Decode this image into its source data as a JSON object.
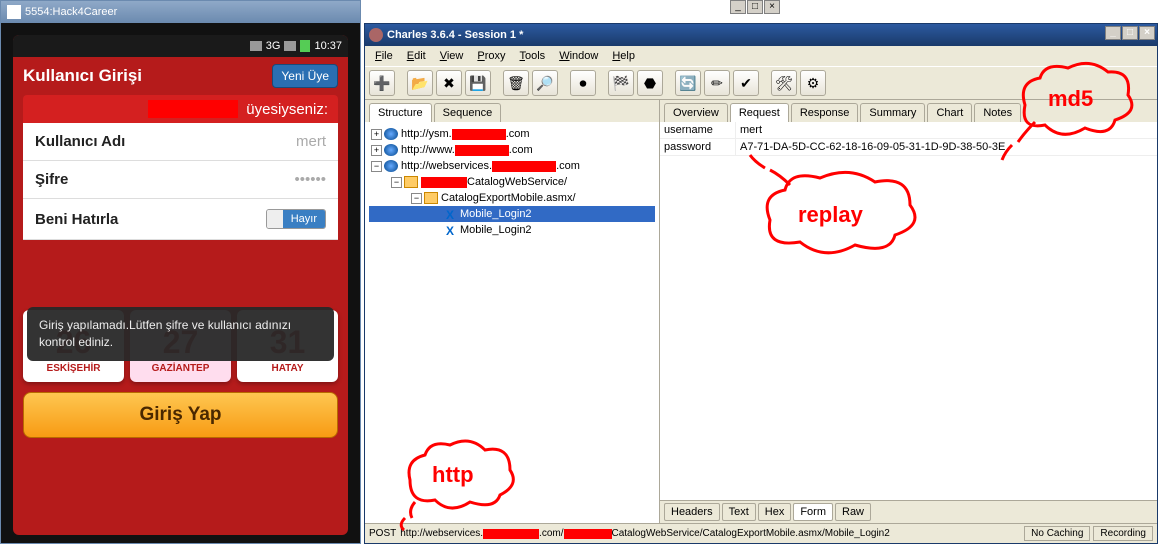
{
  "emulator": {
    "title": "5554:Hack4Career",
    "statusbar": {
      "net": "3G",
      "time": "10:37"
    },
    "app": {
      "header_title": "Kullanıcı Girişi",
      "new_member": "Yeni Üye",
      "banner_suffix": "üyesiyseniz:",
      "username_label": "Kullanıcı Adı",
      "username_value": "mert",
      "password_label": "Şifre",
      "password_mask": "••••••",
      "remember_label": "Beni Hatırla",
      "toggle_on": " ",
      "toggle_off": "Hayır",
      "toast": "Giriş yapılamadı.Lütfen şifre ve kullanıcı adınızı kontrol ediniz.",
      "days": [
        {
          "num": "26",
          "city": "ESKİŞEHİR"
        },
        {
          "num": "27",
          "city": "GAZİANTEP"
        },
        {
          "num": "31",
          "city": "HATAY"
        }
      ],
      "login_button": "Giriş Yap"
    }
  },
  "charles": {
    "title": "Charles 3.6.4 - Session 1 *",
    "menu": [
      "File",
      "Edit",
      "View",
      "Proxy",
      "Tools",
      "Window",
      "Help"
    ],
    "left_tabs": [
      "Structure",
      "Sequence"
    ],
    "tree": {
      "h1_pre": "http://ysm.",
      "h1_post": ".com",
      "h2_pre": "http://www.",
      "h2_post": ".com",
      "h3_pre": "http://webservices.",
      "h3_post": ".com",
      "f1": "CatalogWebService/",
      "f2": "CatalogExportMobile.asmx/",
      "l1": "Mobile_Login2",
      "l2": "Mobile_Login2"
    },
    "right_tabs": [
      "Overview",
      "Request",
      "Response",
      "Summary",
      "Chart",
      "Notes"
    ],
    "request": {
      "rows": [
        {
          "k": "username",
          "v": "mert"
        },
        {
          "k": "password",
          "v": "A7-71-DA-5D-CC-62-18-16-09-05-31-1D-9D-38-50-3E"
        }
      ]
    },
    "bottom_tabs": [
      "Headers",
      "Text",
      "Hex",
      "Form",
      "Raw"
    ],
    "status": {
      "method": "POST",
      "u1": "http://webservices.",
      "u2": ".com/",
      "u3": "CatalogWebService/CatalogExportMobile.asmx/Mobile_Login2",
      "nocaching": "No Caching",
      "recording": "Recording"
    }
  },
  "annotations": {
    "http": "http",
    "replay": "replay",
    "md5": "md5"
  }
}
